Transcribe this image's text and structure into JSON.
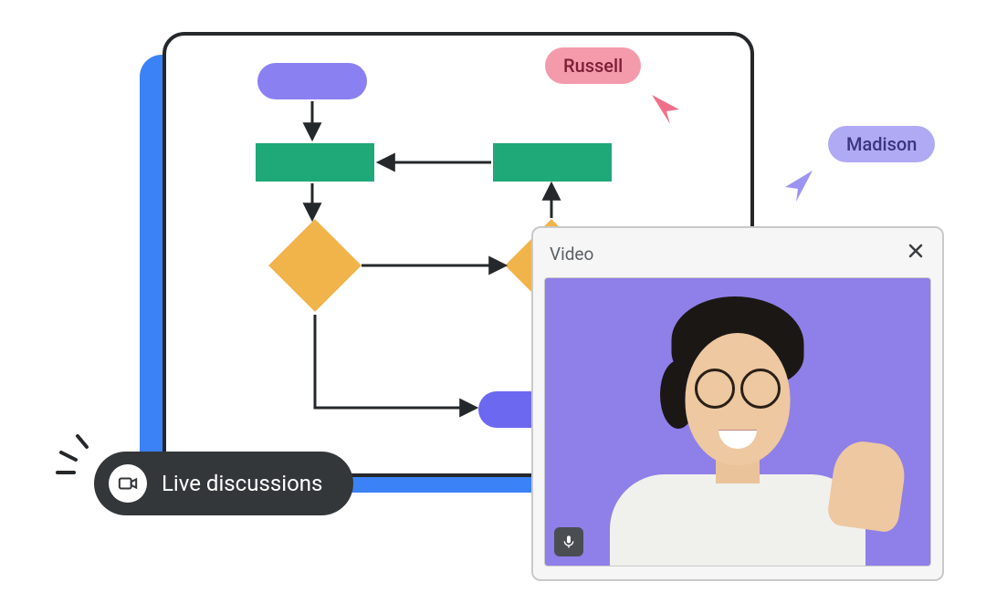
{
  "live_discussions": {
    "label": "Live discussions"
  },
  "cursors": {
    "russell": {
      "name": "Russell",
      "color": "#f39aab"
    },
    "madison": {
      "name": "Madison",
      "color": "#b0a9f4"
    }
  },
  "video_panel": {
    "title": "Video"
  },
  "diagram": {
    "nodes": [
      {
        "id": "start",
        "type": "pill",
        "color": "purple"
      },
      {
        "id": "proc1",
        "type": "rect",
        "color": "green"
      },
      {
        "id": "proc2",
        "type": "rect",
        "color": "green"
      },
      {
        "id": "dec1",
        "type": "diamond",
        "color": "orange"
      },
      {
        "id": "dec2",
        "type": "diamond",
        "color": "orange"
      },
      {
        "id": "end",
        "type": "pill",
        "color": "indigo"
      }
    ],
    "edges": [
      [
        "start",
        "proc1"
      ],
      [
        "proc1",
        "dec1"
      ],
      [
        "proc2",
        "proc1"
      ],
      [
        "dec1",
        "dec2"
      ],
      [
        "dec2",
        "proc2"
      ],
      [
        "dec1",
        "end"
      ]
    ]
  },
  "icons": {
    "camera": "camera-icon",
    "mic": "microphone-icon",
    "close": "close-icon"
  },
  "colors": {
    "accent_blue": "#3b82f6",
    "dark": "#33373a",
    "green": "#1fa878",
    "orange": "#f0b44b",
    "purple_shape": "#8b80f2",
    "video_bg": "#8f7fe8"
  }
}
